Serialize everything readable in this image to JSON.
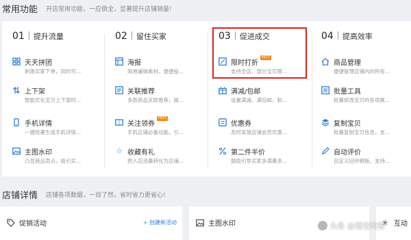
{
  "common": {
    "title": "常用功能",
    "subtitle": "开店常用功能，一应俱全，显著提升店铺销量!"
  },
  "columns": [
    {
      "num": "01",
      "name": "提升流量",
      "items": [
        {
          "icon": "grid-icon",
          "name": "天天拼团",
          "desc": "刺激买家下单，同时可...",
          "tag": ""
        },
        {
          "icon": "sort-arrows-icon",
          "name": "上下架",
          "desc": "智能优化宝贝上下架时...",
          "tag": ""
        },
        {
          "icon": "phone-icon",
          "name": "手机详情",
          "desc": "一键批量生成手机详情...",
          "tag": ""
        },
        {
          "icon": "image-icon",
          "name": "主图水印",
          "desc": "凸显商品卖点，吸引买...",
          "tag": ""
        }
      ]
    },
    {
      "num": "02",
      "name": "留住买家",
      "items": [
        {
          "icon": "poster-icon",
          "name": "海报",
          "desc": "简易编辑素材，便捷投...",
          "tag": ""
        },
        {
          "icon": "link-icon",
          "name": "关联推荐",
          "desc": "多款商品关联推荐，提...",
          "tag": ""
        },
        {
          "icon": "coupon-icon",
          "name": "关注领券",
          "desc": "手机店铺必备功能，引...",
          "tag": "HOT"
        },
        {
          "icon": "star-icon",
          "name": "收藏有礼",
          "desc": "把入店流量转化为店铺...",
          "tag": ""
        }
      ]
    },
    {
      "num": "03",
      "name": "促进成交",
      "items": [
        {
          "icon": "discount-icon",
          "name": "限时打折",
          "desc": "支持全店、部分宝贝限...",
          "tag": "HOT"
        },
        {
          "icon": "gift-icon",
          "name": "满减/包邮",
          "desc": "设置满减、满包邮，刺...",
          "tag": ""
        },
        {
          "icon": "voucher-icon",
          "name": "优惠券",
          "desc": "及时发放店铺会员优惠...",
          "tag": ""
        },
        {
          "icon": "percent-icon",
          "name": "第二件半价",
          "desc": "鼓励引导买家多满量多...",
          "tag": ""
        }
      ]
    },
    {
      "num": "04",
      "name": "提高效率",
      "items": [
        {
          "icon": "home-icon",
          "name": "商品管理",
          "desc": "便捷管理店铺内的所有...",
          "tag": ""
        },
        {
          "icon": "list-icon",
          "name": "批量工具",
          "desc": "批量修改宝贝的各项属...",
          "tag": ""
        },
        {
          "icon": "layers-icon",
          "name": "复制宝贝",
          "desc": "批量复制宝贝信息，支...",
          "tag": ""
        },
        {
          "icon": "pencil-icon",
          "name": "自动评价",
          "desc": "自定义回评模板，支持...",
          "tag": ""
        }
      ]
    }
  ],
  "shop": {
    "title": "店铺详情",
    "subtitle": "店铺各项数据，一目了然，省时省力更省心!"
  },
  "cards": [
    {
      "title": "促销活动",
      "action": "+ 创建新活动"
    },
    {
      "title": "主图水印",
      "action": ""
    },
    {
      "title": "互动",
      "action": ""
    }
  ],
  "watermark": "头条 @悟空问答"
}
